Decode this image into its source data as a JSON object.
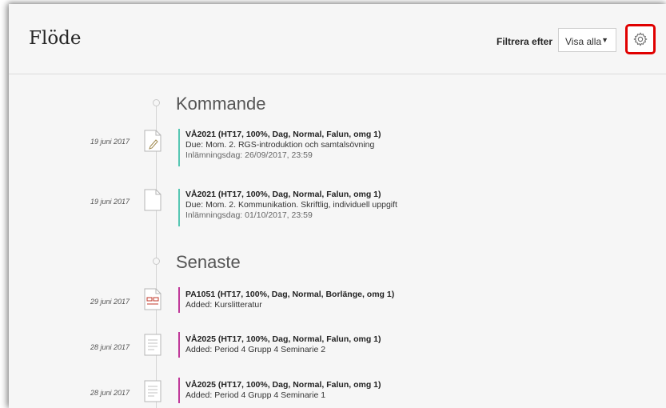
{
  "header": {
    "title": "Flöde",
    "filter_label": "Filtrera efter",
    "filter_value": "Visa alla"
  },
  "sections": [
    {
      "title": "Kommande",
      "items": [
        {
          "date": "19 juni 2017",
          "icon": "document-edit-icon",
          "accent": "#57c7b3",
          "title": "VÅ2021 (HT17, 100%, Dag, Normal, Falun, omg 1)",
          "detail": "Due: Mom. 2. RGS-introduktion och samtalsövning",
          "subdetail": "Inlämningsdag: 26/09/2017, 23:59"
        },
        {
          "date": "19 juni 2017",
          "icon": "document-icon",
          "accent": "#57c7b3",
          "title": "VÅ2021 (HT17, 100%, Dag, Normal, Falun, omg 1)",
          "detail": "Due: Mom. 2. Kommunikation. Skriftlig, individuell uppgift",
          "subdetail": "Inlämningsdag: 01/10/2017, 23:59"
        }
      ]
    },
    {
      "title": "Senaste",
      "items": [
        {
          "date": "29 juni 2017",
          "icon": "content-icon",
          "accent": "#c0399a",
          "title": "PA1051 (HT17, 100%, Dag, Normal, Borlänge, omg 1)",
          "detail": "Added: Kurslitteratur"
        },
        {
          "date": "28 juni 2017",
          "icon": "document-lines-icon",
          "accent": "#c0399a",
          "title": "VÅ2025 (HT17, 100%, Dag, Normal, Falun, omg 1)",
          "detail": "Added: Period 4 Grupp 4 Seminarie 2"
        },
        {
          "date": "28 juni 2017",
          "icon": "document-lines-icon",
          "accent": "#c0399a",
          "title": "VÅ2025 (HT17, 100%, Dag, Normal, Falun, omg 1)",
          "detail": "Added: Period 4 Grupp 4 Seminarie 1"
        }
      ]
    }
  ],
  "colors": {
    "highlight": "#e00000",
    "upcoming_accent": "#57c7b3",
    "recent_accent": "#c0399a"
  }
}
